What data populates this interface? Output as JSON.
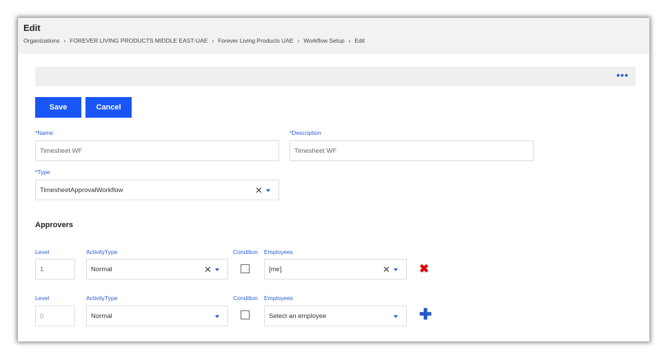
{
  "header": {
    "title": "Edit",
    "breadcrumb": [
      "Organizations",
      "FOREVER LIVING PRODUCTS MIDDLE EAST-UAE",
      "Forever Living Products UAE",
      "Workflow Setup",
      "Edit"
    ],
    "separator": "›"
  },
  "toolbar": {
    "more_label": "•••"
  },
  "actions": {
    "save_label": "Save",
    "cancel_label": "Cancel"
  },
  "form": {
    "name": {
      "label": "*Name",
      "value": "Timesheet WF"
    },
    "description": {
      "label": "*Description",
      "value": "Timesheet WF"
    },
    "type": {
      "label": "*Type",
      "value": "TimesheetApprovalWorkflow"
    }
  },
  "approvers": {
    "title": "Approvers",
    "columns": {
      "level": "Level",
      "activity_type": "ActivityType",
      "condition": "Condition",
      "employees": "Employees"
    },
    "rows": [
      {
        "level": "1",
        "activity_type": "Normal",
        "condition": false,
        "employees": "[me]",
        "action": "delete"
      },
      {
        "level": "0",
        "activity_type": "Normal",
        "condition": false,
        "employees": "Select an employee",
        "action": "add"
      }
    ]
  },
  "glyphs": {
    "clear": "✕",
    "delete": "✖",
    "add": "✚"
  },
  "colors": {
    "primary": "#1a56f5",
    "link_label": "#2b5bd7",
    "danger": "#e00000",
    "header_bg": "#f2f2f2"
  }
}
